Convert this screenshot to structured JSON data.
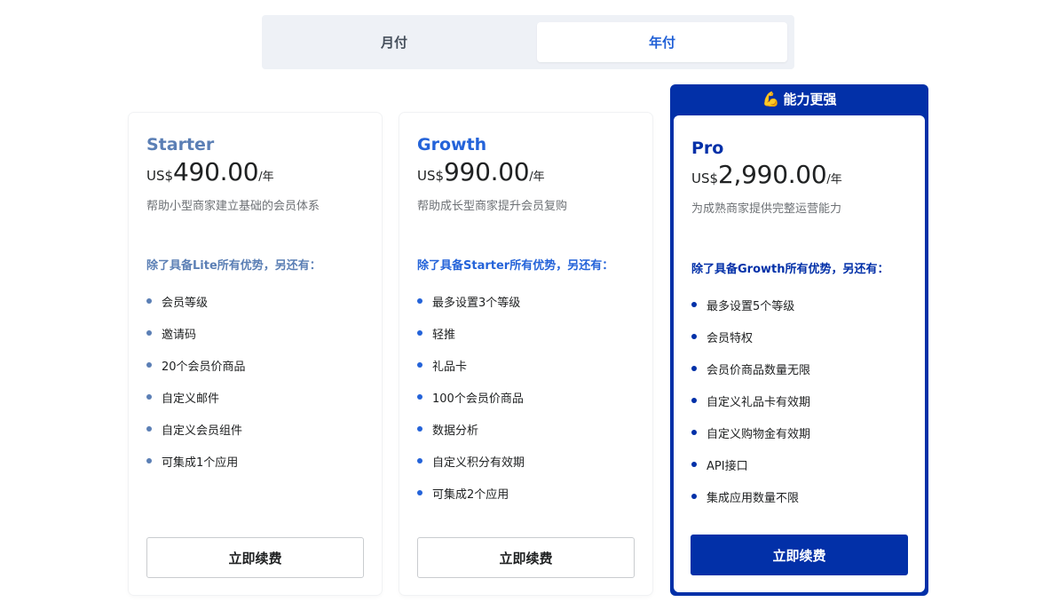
{
  "toggle": {
    "monthly_label": "月付",
    "yearly_label": "年付",
    "selected": "年付"
  },
  "plans": [
    {
      "name": "Starter",
      "currency": "US$",
      "amount": "490.00",
      "period": "/年",
      "description": "帮助小型商家建立基础的会员体系",
      "features_heading": "除了具备Lite所有优势，另还有：",
      "features": [
        "会员等级",
        "邀请码",
        "20个会员价商品",
        "自定义邮件",
        "自定义会员组件",
        "可集成1个应用"
      ],
      "cta_label": "立即续费"
    },
    {
      "name": "Growth",
      "currency": "US$",
      "amount": "990.00",
      "period": "/年",
      "description": "帮助成长型商家提升会员复购",
      "features_heading": "除了具备Starter所有优势，另还有：",
      "features": [
        "最多设置3个等级",
        "轻推",
        "礼品卡",
        "100个会员价商品",
        "数据分析",
        "自定义积分有效期",
        "可集成2个应用"
      ],
      "cta_label": "立即续费"
    },
    {
      "badge_icon": "💪",
      "badge_label": "能力更强",
      "name": "Pro",
      "currency": "US$",
      "amount": "2,990.00",
      "period": "/年",
      "description": "为成熟商家提供完整运营能力",
      "features_heading": "除了具备Growth所有优势，另还有：",
      "features": [
        "最多设置5个等级",
        "会员特权",
        "会员价商品数量无限",
        "自定义礼品卡有效期",
        "自定义购物金有效期",
        "API接口",
        "集成应用数量不限"
      ],
      "cta_label": "立即续费"
    }
  ],
  "colors": {
    "starter_accent": "#5b7fb5",
    "growth_accent": "#2463d9",
    "pro_accent": "#0230a8"
  }
}
